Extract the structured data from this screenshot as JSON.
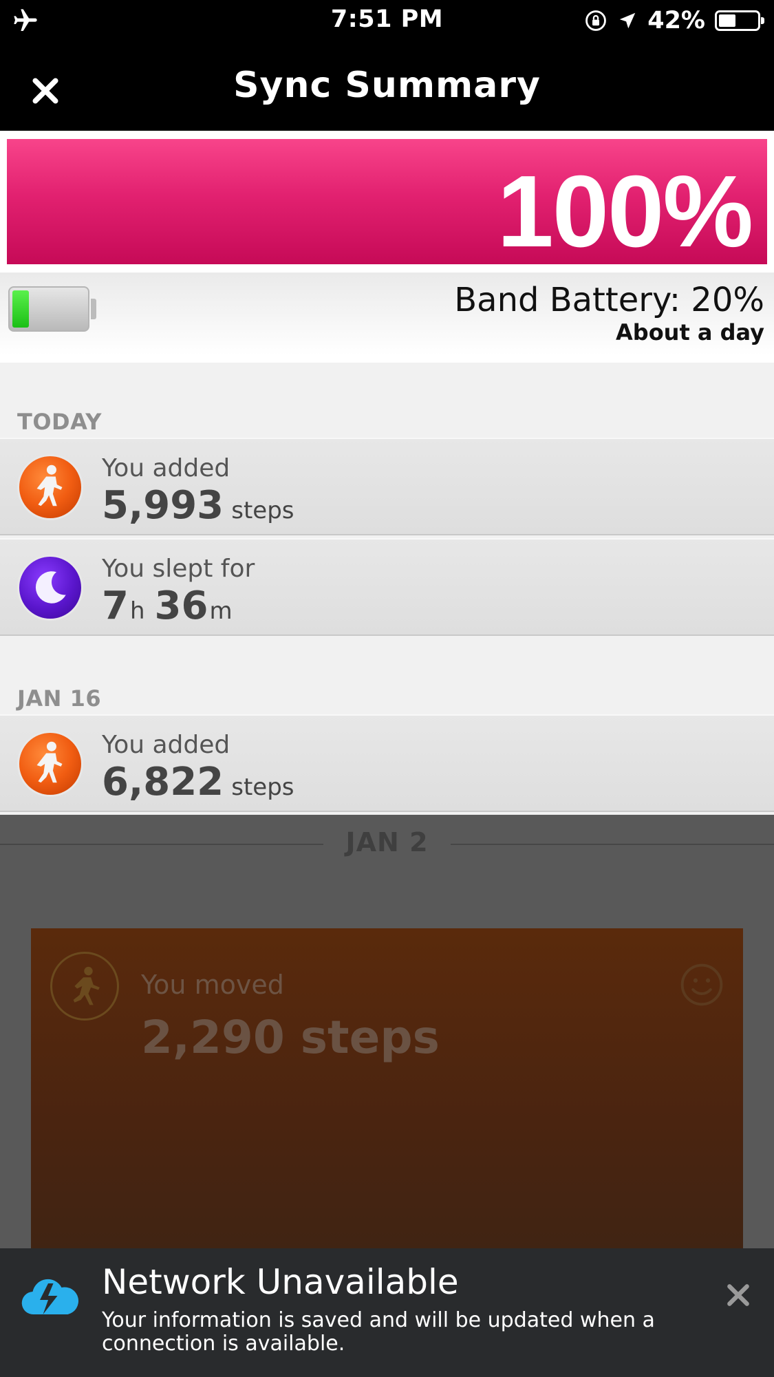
{
  "status_bar": {
    "time": "7:51 PM",
    "battery_percent": "42%",
    "icons": [
      "airplane-icon",
      "rotation-lock-icon",
      "location-arrow-icon",
      "battery-icon"
    ]
  },
  "nav": {
    "title": "Sync Summary",
    "close_icon": "close-icon"
  },
  "sync": {
    "progress_label": "100%",
    "progress_value": 1.0,
    "progress_color": "#e22170",
    "band_battery_label": "Band Battery: 20%",
    "band_battery_level": 0.2,
    "band_battery_sub": "About a day"
  },
  "sections": [
    {
      "header": "TODAY",
      "rows": [
        {
          "icon": "walking-figure-icon",
          "label": "You added",
          "value": "5,993",
          "unit": "steps"
        },
        {
          "icon": "moon-icon",
          "label": "You slept for",
          "hours": "7",
          "hours_unit": "h",
          "minutes": "36",
          "minutes_unit": "m"
        }
      ]
    },
    {
      "header": "JAN 16",
      "rows": [
        {
          "icon": "walking-figure-icon",
          "label": "You added",
          "value": "6,822",
          "unit": "steps"
        }
      ]
    }
  ],
  "feed": {
    "date": "JAN 2",
    "card": {
      "icon": "running-figure-icon",
      "moved_label": "You moved",
      "steps": "2,290 steps",
      "mood_icon": "smiley-icon"
    }
  },
  "toast": {
    "icon": "cloud-lightning-icon",
    "title": "Network Unavailable",
    "body": "Your information is saved and will be updated when a connection is available.",
    "close_icon": "close-icon"
  }
}
